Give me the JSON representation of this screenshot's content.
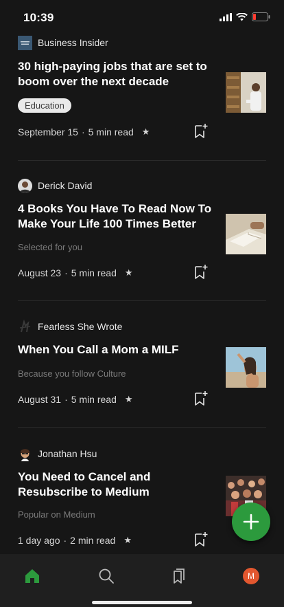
{
  "status_bar": {
    "time": "10:39"
  },
  "articles": [
    {
      "publisher": "Business Insider",
      "title": "30 high-paying jobs that are set to boom over the next decade",
      "tag": "Education",
      "date": "September 15",
      "read_time": "5 min read",
      "member_only": true
    },
    {
      "publisher": "Derick David",
      "title": "4 Books You Have To Read Now To Make Your Life 100 Times Better",
      "reason": "Selected for you",
      "date": "August 23",
      "read_time": "5 min read",
      "member_only": true
    },
    {
      "publisher": "Fearless She Wrote",
      "title": "When You Call a Mom a MILF",
      "reason": "Because you follow Culture",
      "date": "August 31",
      "read_time": "5 min read",
      "member_only": true
    },
    {
      "publisher": "Jonathan Hsu",
      "title": "You Need to Cancel and Resubscribe to Medium",
      "reason": "Popular on Medium",
      "date": "1 day ago",
      "read_time": "2 min read",
      "member_only": true
    }
  ],
  "separator": "·",
  "star_glyph": "★",
  "fab": {
    "icon": "plus-icon"
  },
  "bottom_nav": {
    "items": [
      "home-icon",
      "search-icon",
      "bookmarks-icon",
      "profile-avatar"
    ],
    "active": "home-icon",
    "avatar_initial": "M"
  },
  "colors": {
    "background": "#161616",
    "accent_green": "#2c9a3d",
    "avatar_orange": "#e2572f"
  }
}
